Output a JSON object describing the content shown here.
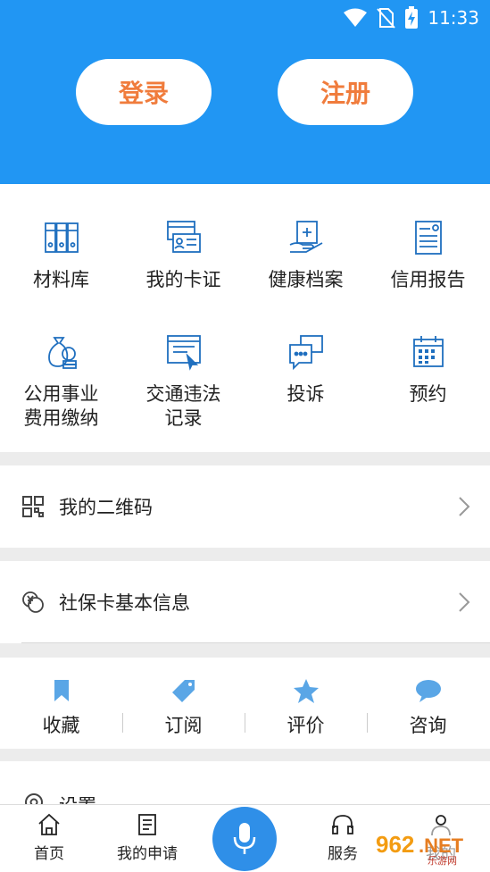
{
  "status_bar": {
    "time": "11:33"
  },
  "auth": {
    "login_label": "登录",
    "register_label": "注册"
  },
  "services": [
    {
      "label": "材料库",
      "icon": "binders-icon"
    },
    {
      "label": "我的卡证",
      "icon": "id-card-icon"
    },
    {
      "label": "健康档案",
      "icon": "health-record-icon"
    },
    {
      "label": "信用报告",
      "icon": "report-icon"
    },
    {
      "label": "公用事业\n费用缴纳",
      "icon": "utility-payment-icon"
    },
    {
      "label": "交通违法\n记录",
      "icon": "traffic-record-icon"
    },
    {
      "label": "投诉",
      "icon": "complaint-icon"
    },
    {
      "label": "预约",
      "icon": "calendar-icon"
    }
  ],
  "rows": {
    "qr_label": "我的二维码",
    "social_card_label": "社保卡基本信息"
  },
  "actions": [
    {
      "label": "收藏",
      "icon": "bookmark-icon"
    },
    {
      "label": "订阅",
      "icon": "tag-icon"
    },
    {
      "label": "评价",
      "icon": "star-icon"
    },
    {
      "label": "咨询",
      "icon": "chat-icon"
    }
  ],
  "settings": {
    "label": "设置"
  },
  "tabbar": {
    "home_label": "首页",
    "applications_label": "我的申请",
    "services_label": "服务",
    "profile_label": "我的"
  },
  "watermark": {
    "text": "962.NET",
    "subtext": "乐游网"
  },
  "colors": {
    "header": "#2196f3",
    "accent_orange": "#f07c3c",
    "icon_blue": "#1f6fbf",
    "action_blue": "#5aa6e6"
  }
}
